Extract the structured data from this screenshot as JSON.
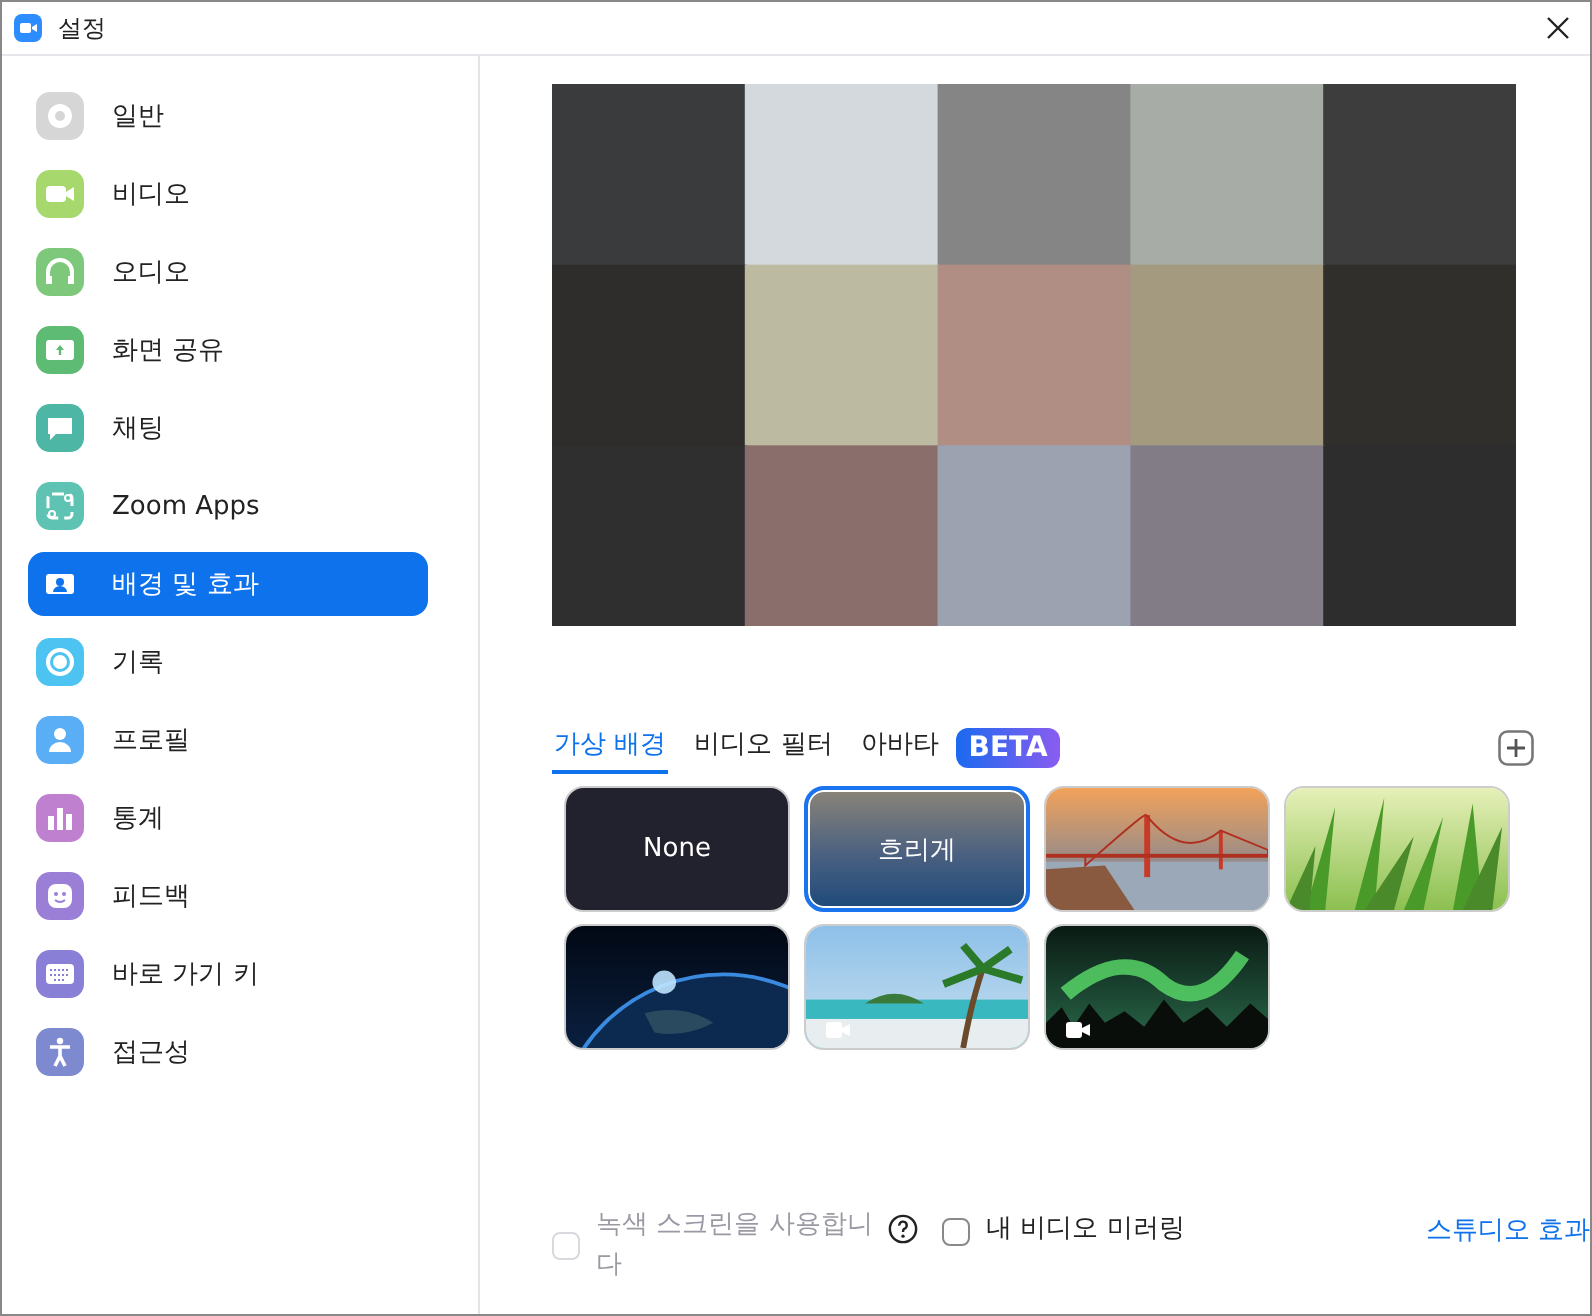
{
  "window": {
    "title": "설정"
  },
  "sidebar": {
    "items": [
      {
        "label": "일반",
        "selected": false
      },
      {
        "label": "비디오",
        "selected": false
      },
      {
        "label": "오디오",
        "selected": false
      },
      {
        "label": "화면 공유",
        "selected": false
      },
      {
        "label": "채팅",
        "selected": false
      },
      {
        "label": "Zoom Apps",
        "selected": false
      },
      {
        "label": "배경 및 효과",
        "selected": true
      },
      {
        "label": "기록",
        "selected": false
      },
      {
        "label": "프로필",
        "selected": false
      },
      {
        "label": "통계",
        "selected": false
      },
      {
        "label": "피드백",
        "selected": false
      },
      {
        "label": "바로 가기 키",
        "selected": false
      },
      {
        "label": "접근성",
        "selected": false
      }
    ]
  },
  "preview": {
    "kind": "picture"
  },
  "tabs": [
    {
      "label": "가상 배경",
      "selected": true
    },
    {
      "label": "비디오 필터",
      "selected": false
    },
    {
      "label": "아바타",
      "selected": false
    }
  ],
  "beta_badge": "BETA",
  "backgrounds": [
    {
      "kind": "none",
      "label": "None",
      "selected": false
    },
    {
      "kind": "blur",
      "label": "흐리게",
      "selected": true
    },
    {
      "kind": "picture",
      "selected": false,
      "video": false
    },
    {
      "kind": "picture",
      "selected": false,
      "video": false
    },
    {
      "kind": "picture",
      "selected": false,
      "video": false
    },
    {
      "kind": "picture",
      "selected": false,
      "video": true
    },
    {
      "kind": "picture",
      "selected": false,
      "video": true
    }
  ],
  "footer": {
    "green_screen": {
      "label": "녹색 스크린을 사용합니다",
      "checked": false,
      "disabled": true
    },
    "mirror": {
      "label": "내 비디오 미러링",
      "checked": false
    },
    "studio_link": "스튜디오 효과"
  }
}
